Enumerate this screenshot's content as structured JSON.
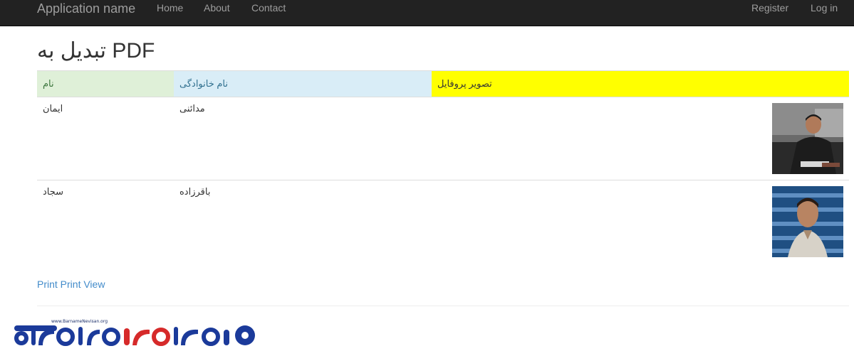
{
  "navbar": {
    "brand": "Application name",
    "left_links": [
      "Home",
      "About",
      "Contact"
    ],
    "right_links": [
      "Register",
      "Log in"
    ]
  },
  "page": {
    "title": "تبدیل به PDF"
  },
  "table": {
    "headers": {
      "first_name": "نام",
      "last_name": "نام خانوادگی",
      "photo": "تصویر پروفایل"
    },
    "header_colors": {
      "first_name": "#dff0d8",
      "last_name": "#d9edf7",
      "photo": "#ffff00"
    },
    "rows": [
      {
        "first_name": "ایمان",
        "last_name": "مدائنی",
        "photo": "profile-photo-man-in-office"
      },
      {
        "first_name": "سجاد",
        "last_name": "باقرزاده",
        "photo": "profile-photo-man-code-background"
      }
    ]
  },
  "actions": {
    "print_link": "Print Print View"
  },
  "footer": {
    "logo_caption": "www.BarnameNevisan.org",
    "logo_text": "برنامه نویسان"
  }
}
